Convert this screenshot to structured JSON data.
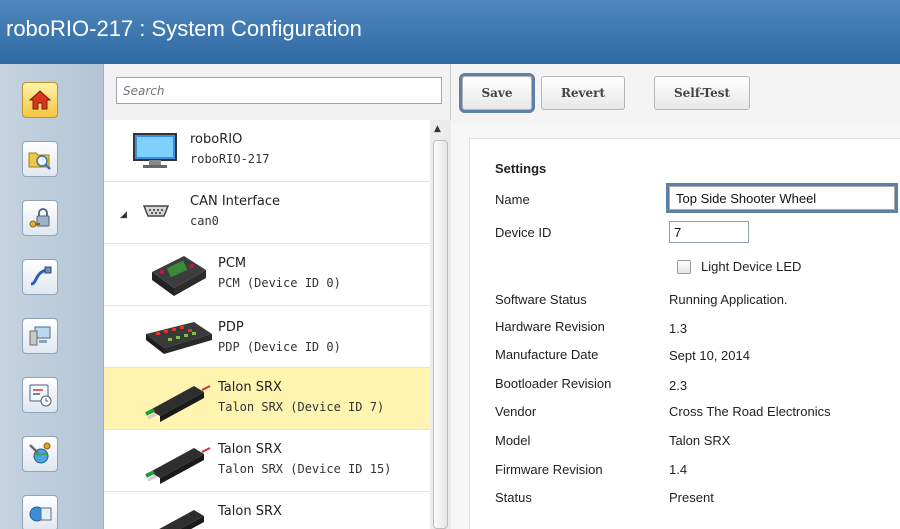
{
  "window": {
    "title": "roboRIO-217 : System Configuration"
  },
  "rail": {
    "items": [
      {
        "icon": "home-icon",
        "active": true
      },
      {
        "icon": "folder-search-icon",
        "active": false
      },
      {
        "icon": "lock-key-icon",
        "active": false
      },
      {
        "icon": "network-cable-icon",
        "active": false
      },
      {
        "icon": "computer-icon",
        "active": false
      },
      {
        "icon": "monitoring-clock-icon",
        "active": false
      },
      {
        "icon": "tools-globe-icon",
        "active": false
      },
      {
        "icon": "globe-window-icon",
        "active": false
      }
    ]
  },
  "search": {
    "placeholder": "Search"
  },
  "devices": [
    {
      "name": "roboRIO",
      "sub": "roboRIO-217",
      "icon": "monitor-icon",
      "selected": false
    },
    {
      "name": "CAN Interface",
      "sub": "can0",
      "icon": "serial-port-icon",
      "selected": false,
      "expanded": true
    },
    {
      "name": "PCM",
      "sub": "PCM (Device ID 0)",
      "icon": "pcm-module-icon",
      "selected": false
    },
    {
      "name": "PDP",
      "sub": "PDP (Device ID 0)",
      "icon": "pdp-board-icon",
      "selected": false
    },
    {
      "name": "Talon SRX",
      "sub": "Talon SRX (Device ID 7)",
      "icon": "talon-srx-icon",
      "selected": true
    },
    {
      "name": "Talon SRX",
      "sub": "Talon SRX (Device ID 15)",
      "icon": "talon-srx-icon",
      "selected": false
    },
    {
      "name": "Talon SRX",
      "sub": "",
      "icon": "talon-srx-icon",
      "selected": false
    }
  ],
  "toolbar": {
    "save_label": "Save",
    "revert_label": "Revert",
    "selftest_label": "Self-Test"
  },
  "settings": {
    "title": "Settings",
    "name_label": "Name",
    "name_value": "Top Side Shooter Wheel",
    "device_id_label": "Device ID",
    "device_id_value": "7",
    "led_label": "Light Device LED",
    "led_checked": false,
    "rows": [
      {
        "label": "Software Status",
        "value": "Running Application."
      },
      {
        "label": "Hardware Revision",
        "value": "1.3"
      },
      {
        "label": "Manufacture Date",
        "value": "Sept 10, 2014"
      },
      {
        "label": "Bootloader Revision",
        "value": "2.3"
      },
      {
        "label": "Vendor",
        "value": "Cross The Road Electronics"
      },
      {
        "label": "Model",
        "value": "Talon SRX"
      },
      {
        "label": "Firmware Revision",
        "value": "1.4"
      },
      {
        "label": "Status",
        "value": "Present"
      }
    ]
  },
  "colors": {
    "titlebar": "#3a74ad",
    "selected_row": "#fff4b0",
    "focus_outline": "#5d7fa8"
  }
}
